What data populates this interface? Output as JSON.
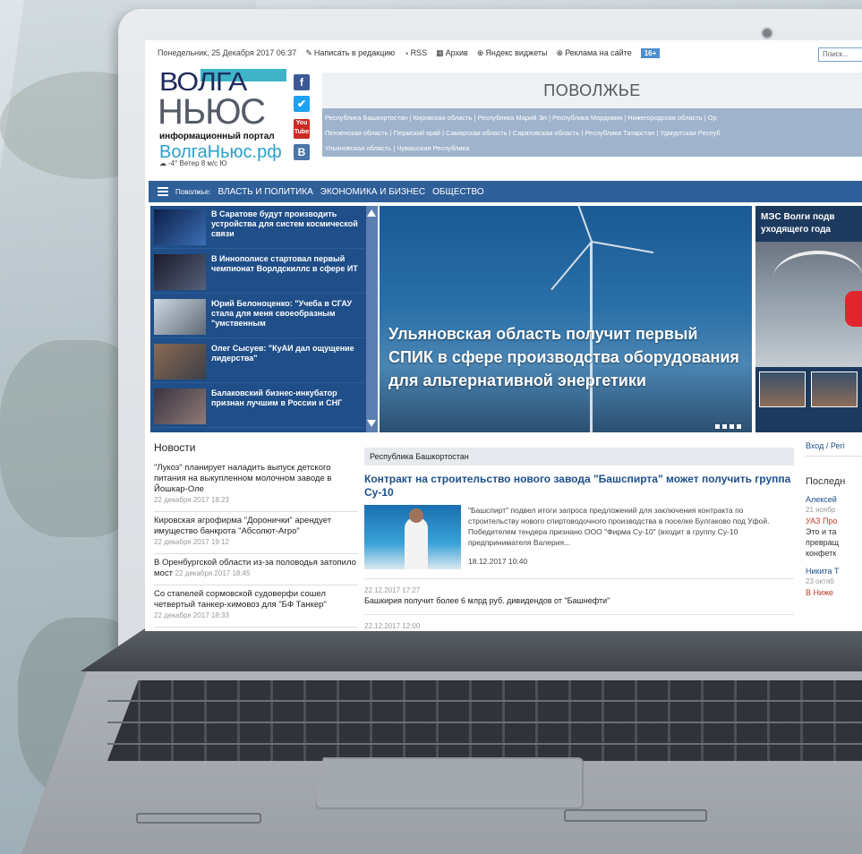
{
  "header": {
    "date": "Понедельник, 25 Декабря 2017 06:37",
    "links": [
      "Написать в редакцию",
      "RSS",
      "Архив",
      "Яндекс виджеты",
      "Реклама на сайте"
    ],
    "age_badge": "16+",
    "search_placeholder": "Поиск..."
  },
  "logo": {
    "line1": "ВОЛГА",
    "line2": "НЬЮС",
    "tagline": "информационный портал",
    "domain": "ВолгаНьюс.рф",
    "weather": "-4° Ветер 8 м/с Ю"
  },
  "social": [
    "f",
    "t",
    "You Tube",
    "В"
  ],
  "region": {
    "title": "ПОВОЛЖЬЕ",
    "links": [
      "Республика Башкортостан",
      "Кировская область",
      "Республика Марий Эл",
      "Республика Мордовия",
      "Нижегородская область",
      "Ор",
      "Пензенская область",
      "Пермский край",
      "Самарская область",
      "Саратовская область",
      "Республика Татарстан",
      "Удмуртская Респуб",
      "Ульяновская область",
      "Чувашская Республика"
    ]
  },
  "nav": {
    "prefix": "Поволжье:",
    "items": [
      "ВЛАСТЬ И ПОЛИТИКА",
      "ЭКОНОМИКА И БИЗНЕС",
      "ОБЩЕСТВО"
    ]
  },
  "side_news": [
    "В Саратове будут производить устройства для систем космической связи",
    "В Иннополисе стартовал первый чемпионат Ворлдскиллс в сфере ИТ",
    "Юрий Белоноценко: \"Учеба в СГАУ стала для меня своеобразным \"умственным",
    "Олег Сысуев: \"КуАИ дал ощущение лидерства\"",
    "Балаковский бизнес-инкубатор признан лучшим в России и СНГ"
  ],
  "featured": {
    "headline": "Ульяновская область получит первый СПИК в сфере производства оборудования для альтернативной энергетики"
  },
  "right_feature": {
    "title": "МЭС Волги подв уходящего года"
  },
  "news": {
    "heading": "Новости",
    "items": [
      {
        "text": "\"Лукоз\" планирует наладить выпуск детского питания на выкупленном молочном заводе в Йошкар-Оле",
        "date": "22 декабря 2017 18:23"
      },
      {
        "text": "Кировская агрофирма \"Доронички\" арендует имущество банкрота \"Абсолют-Агро\"",
        "date": "22 декабря 2017 19:12"
      },
      {
        "text": "В Оренбургской области из-за половодья затопило мост",
        "date": "22 декабря 2017 18:45"
      },
      {
        "text": "Со стапелей сормовской судоверфи сошел четвертый танкер-химовоз для \"БФ Танкер\"",
        "date": "22 декабря 2017 18:33"
      }
    ]
  },
  "center": {
    "category": "Республика Башкортостан",
    "title": "Контракт на строительство нового завода \"Башспирта\" может получить группа Су-10",
    "text": "\"Башспирт\" подвел итоги запроса предложений для заключения контракта по строительству нового спиртоводочного производства в поселке Булгаково под Уфой. Победителем тендера признано ООО \"Фирма Су-10\" (входит в группу Су-10 предпринимателя Валерия...",
    "time": "18.12.2017 10:40",
    "briefs": [
      {
        "date": "22.12.2017 17:27",
        "text": "Башкирия получит более 6 млрд руб. дивидендов от \"Башнефти\""
      },
      {
        "date": "22.12.2017 12:00",
        "text": ""
      }
    ]
  },
  "right_col": {
    "login": "Вход / Регі",
    "last_comments": "Последн",
    "comments": [
      {
        "name": "Алексей",
        "date": "21 ноябр",
        "topic": "УАЗ Про",
        "text": "Это и та превращ конфетк"
      },
      {
        "name": "Никита Т",
        "date": "23 октяб",
        "topic": "В Ниже",
        "text": ""
      }
    ]
  }
}
